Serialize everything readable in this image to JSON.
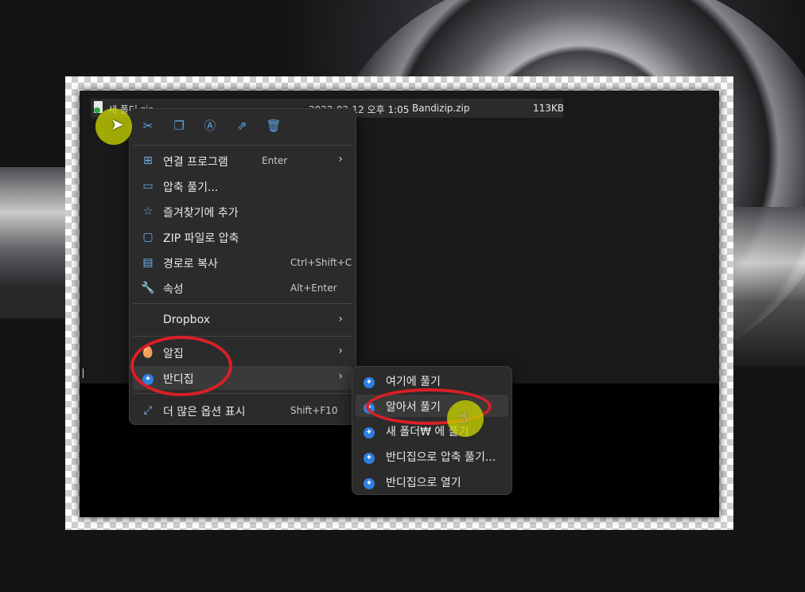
{
  "file_row": {
    "name": "새 폴더.zip",
    "date": "2022-02-12 오후 1:05",
    "type": "Bandizip.zip",
    "size": "113KB"
  },
  "toolbar": {
    "cut": "cut-icon",
    "copy": "copy-icon",
    "rename": "rename-icon",
    "share": "share-icon",
    "delete": "delete-icon"
  },
  "menu": {
    "open_with": {
      "label": "연결 프로그램",
      "shortcut": "Enter"
    },
    "extract": {
      "label": "압축 풀기..."
    },
    "favorites": {
      "label": "즐겨찾기에 추가"
    },
    "zip": {
      "label": "ZIP 파일로 압축"
    },
    "copy_path": {
      "label": "경로로 복사",
      "shortcut": "Ctrl+Shift+C"
    },
    "properties": {
      "label": "속성",
      "shortcut": "Alt+Enter"
    },
    "dropbox": {
      "label": "Dropbox"
    },
    "alzip": {
      "label": "알집"
    },
    "bandizip": {
      "label": "반디집"
    },
    "more": {
      "label": "더 많은 옵션 표시",
      "shortcut": "Shift+F10"
    }
  },
  "submenu": [
    {
      "label": "여기에 풀기"
    },
    {
      "label": "알아서 풀기"
    },
    {
      "label": "새 폴더₩ 에 풀기"
    },
    {
      "label": "반디집으로 압축 풀기..."
    },
    {
      "label": "반디집으로 열기"
    }
  ],
  "colors": {
    "accent": "#60a5e8",
    "highlight_ring": "#d81f26",
    "cursor_dot": "#c8d200"
  }
}
